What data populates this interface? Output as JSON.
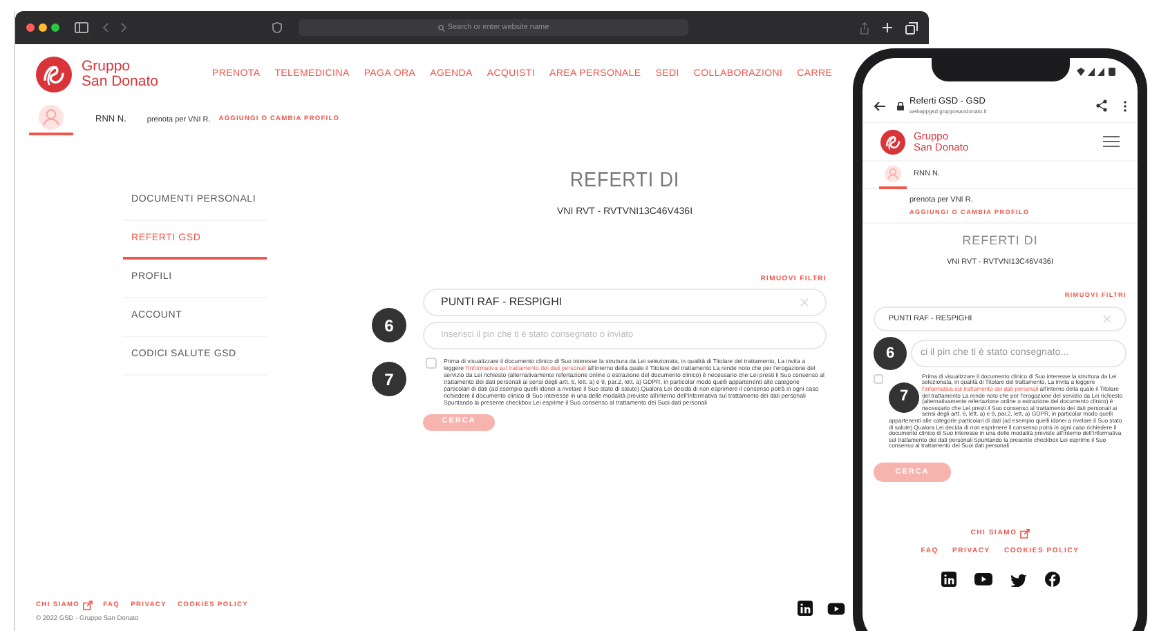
{
  "browser": {
    "address_placeholder": "Search or enter website name"
  },
  "desktop": {
    "logo_text": [
      "Gruppo",
      "San Donato"
    ],
    "nav": [
      "PRENOTA",
      "TELEMEDICINA",
      "PAGA ORA",
      "AGENDA",
      "ACQUISTI",
      "AREA PERSONALE",
      "SEDI",
      "COLLABORAZIONI",
      "CARRE"
    ],
    "user": {
      "name": "RNN N.",
      "booking_for": "prenota per VNI R.",
      "change_profile": "AGGIUNGI O CAMBIA PROFILO"
    },
    "sidebar": [
      {
        "label": "DOCUMENTI PERSONALI",
        "selected": false
      },
      {
        "label": "REFERTI GSD",
        "selected": true
      },
      {
        "label": "PROFILI",
        "selected": false
      },
      {
        "label": "ACCOUNT",
        "selected": false
      },
      {
        "label": "CODICI SALUTE GSD",
        "selected": false
      }
    ],
    "title": "REFERTI DI",
    "subtitle": "VNI RVT - RVTVNI13C46V436I",
    "remove_filters": "RIMUOVI FILTRI",
    "location_field": {
      "value": "PUNTI RAF - RESPIGHI"
    },
    "pin_field": {
      "placeholder": "Inserisci il pin che ti è stato consegnato o inviato"
    },
    "consent": {
      "checked": false,
      "before": "Prima di visualizzare il documento clinico di Suo interesse la struttura da Lei selezionata, in qualità di Titolare del trattamento, La invita a leggere",
      "link": "l'Informativa sul trattamento dei dati personali",
      "after": "all'interno della quale il Titolare del trattamento La rende noto che per l'erogazione del servizio da Lei richiesto (alternativamente refertazione online o estrazione del documento clinico) è necessario che Lei presti il Suo consenso al trattamento dei dati personali ai sensi degli artt. 6, lett. a) e 9, par.2, lett. a) GDPR, in particolar modo quelli appartenenti alle categorie particolari di dati (ad esempio quelli idonei a rivelare il Suo stato di salute).Qualora Lei decida di non esprimere il consenso potrà in ogni caso richiedere il documento clinico di Suo interesse in una delle modalità previste all'interno dell'Informativa sul trattamento dei dati personali Spuntando la presente checkbox Lei esprime il Suo consenso al trattamento dei Suoi dati personali"
    },
    "search_button": {
      "label": "CERCA",
      "disabled": true
    },
    "callouts": [
      "6",
      "7"
    ],
    "footer": {
      "links": [
        "CHI SIAMO",
        "FAQ",
        "PRIVACY",
        "COOKIES POLICY"
      ],
      "copyright": "© 2022 GSD - Gruppo San Donato"
    }
  },
  "phone": {
    "tab_title": "Referti GSD - GSD",
    "url": "webappgsd.grupposandonato.it",
    "logo_text": [
      "Gruppo",
      "San Donato"
    ],
    "user": {
      "name": "RNN N.",
      "booking_for": "prenota per VNI R.",
      "change_profile": "AGGIUNGI O CAMBIA PROFILO"
    },
    "title": "REFERTI DI",
    "subtitle": "VNI RVT - RVTVNI13C46V436I",
    "remove_filters": "RIMUOVI FILTRI",
    "location_field": {
      "value": "PUNTI RAF - RESPIGHI"
    },
    "pin_field": {
      "placeholder": "ci il pin che ti è stato consegnato..."
    },
    "consent": {
      "checked": false,
      "before": "Prima di visualizzare il documento clinico di Suo interesse la struttura da Lei selezionata, in qualità di Titolare del trattamento, La invita a leggere",
      "link": "l'Informativa sul trattamento dei dati personali",
      "after": "all'interno della quale il Titolare del trattamento La rende noto che per l'erogazione del servizio da Lei richiesto (alternativamente refertazione online o estrazione del documento clinico) è necessario che Lei presti il Suo consenso al trattamento dei dati personali ai sensi degli artt. 6, lett. a) e 9, par.2, lett. a) GDPR, in particolar modo quelli appartenenti alle categorie particolari di dati (ad esempio quelli idonei a rivelare il Suo stato di salute).Qualora Lei decida di non esprimere il consenso potrà in ogni caso richiedere il documento clinico di Suo interesse in una delle modalità previste all'interno dell'Informativa sul trattamento dei dati personali Spuntando la presente checkbox Lei esprime il Suo consenso al trattamento dei Suoi dati personali"
    },
    "search_button": {
      "label": "CERCA",
      "disabled": true
    },
    "callouts": [
      "6",
      "7"
    ],
    "footer": {
      "about": "CHI SIAMO",
      "links": [
        "FAQ",
        "PRIVACY",
        "COOKIES POLICY"
      ]
    }
  }
}
